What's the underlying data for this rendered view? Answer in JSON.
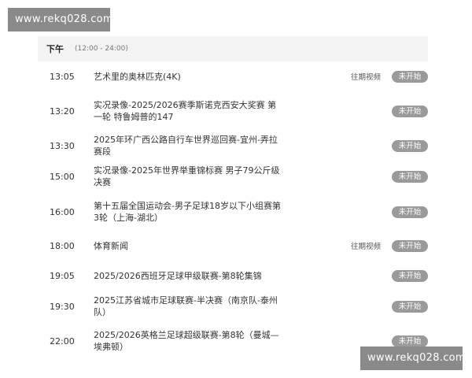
{
  "watermarks": {
    "top": "www.rekq028.com",
    "bottom": "www.rekq028.com"
  },
  "period": {
    "name": "下午",
    "range": "(12:00 - 24:00)"
  },
  "rows": [
    {
      "time": "13:05",
      "title": "艺术里的奥林匹克(4K)",
      "replay": "往期视频",
      "status": "未开始"
    },
    {
      "time": "13:20",
      "title": "实况录像-2025/2026赛季斯诺克西安大奖赛 第一轮 特鲁姆普的147",
      "replay": "",
      "status": "未开始"
    },
    {
      "time": "13:30",
      "title": "2025年环广西公路自行车世界巡回赛-宜州-弄拉赛段",
      "replay": "",
      "status": "未开始"
    },
    {
      "time": "15:00",
      "title": "实况录像-2025年世界举重锦标赛 男子79公斤级决赛",
      "replay": "",
      "status": "未开始"
    },
    {
      "time": "16:00",
      "title": "第十五届全国运动会-男子足球18岁以下小组赛第3轮（上海-湖北）",
      "replay": "",
      "status": "未开始"
    },
    {
      "time": "18:00",
      "title": "体育新闻",
      "replay": "往期视频",
      "status": "未开始"
    },
    {
      "time": "19:05",
      "title": "2025/2026西班牙足球甲级联赛-第8轮集锦",
      "replay": "",
      "status": "未开始"
    },
    {
      "time": "19:30",
      "title": "2025江苏省城市足球联赛-半决赛（南京队-泰州队）",
      "replay": "",
      "status": "未开始"
    },
    {
      "time": "22:00",
      "title": "2025/2026英格兰足球超级联赛-第8轮（曼城—埃弗顿）",
      "replay": "",
      "status": "未开始"
    }
  ]
}
